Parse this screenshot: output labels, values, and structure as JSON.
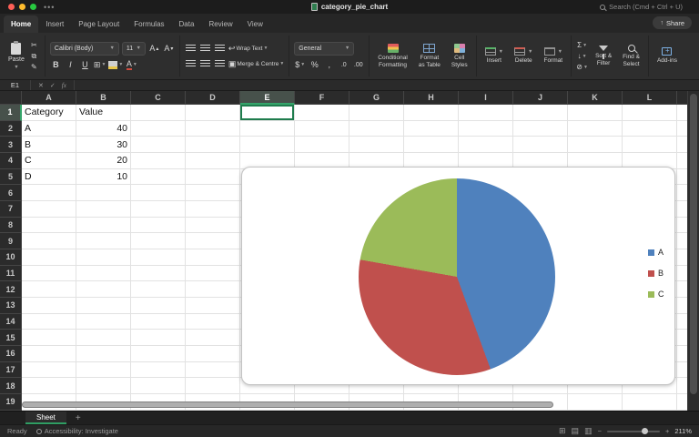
{
  "window": {
    "title": "category_pie_chart",
    "search_label": "Search (Cmd + Ctrl + U)",
    "share_label": "Share"
  },
  "tabs": [
    {
      "label": "Home",
      "active": true
    },
    {
      "label": "Insert",
      "active": false
    },
    {
      "label": "Page Layout",
      "active": false
    },
    {
      "label": "Formulas",
      "active": false
    },
    {
      "label": "Data",
      "active": false
    },
    {
      "label": "Review",
      "active": false
    },
    {
      "label": "View",
      "active": false
    }
  ],
  "ribbon": {
    "paste": "Paste",
    "font_name": "Calibri (Body)",
    "font_size": "11",
    "bold": "B",
    "italic": "I",
    "underline": "U",
    "wrap": "Wrap Text",
    "merge": "Merge & Centre",
    "number_format": "General",
    "cf1": "Conditional",
    "cf2": "Formatting",
    "ft1": "Format",
    "ft2": "as Table",
    "cs1": "Cell",
    "cs2": "Styles",
    "insert": "Insert",
    "delete": "Delete",
    "format": "Format",
    "sf1": "Sort &",
    "sf2": "Filter",
    "fs1": "Find &",
    "fs2": "Select",
    "addins": "Add-ins"
  },
  "formula_bar": {
    "cell_ref": "E1",
    "fx": "fx"
  },
  "grid": {
    "columns": [
      "A",
      "B",
      "C",
      "D",
      "E",
      "F",
      "G",
      "H",
      "I",
      "J",
      "K",
      "L"
    ],
    "row_count": 19,
    "selected_column": "E",
    "selected_row": 1,
    "selected_cell": "E1",
    "cells": [
      {
        "ref": "A1",
        "col": "A",
        "row": 1,
        "text": "Category",
        "align": "left"
      },
      {
        "ref": "B1",
        "col": "B",
        "row": 1,
        "text": "Value",
        "align": "left"
      },
      {
        "ref": "A2",
        "col": "A",
        "row": 2,
        "text": "A",
        "align": "left"
      },
      {
        "ref": "B2",
        "col": "B",
        "row": 2,
        "text": "40",
        "align": "right"
      },
      {
        "ref": "A3",
        "col": "A",
        "row": 3,
        "text": "B",
        "align": "left"
      },
      {
        "ref": "B3",
        "col": "B",
        "row": 3,
        "text": "30",
        "align": "right"
      },
      {
        "ref": "A4",
        "col": "A",
        "row": 4,
        "text": "C",
        "align": "left"
      },
      {
        "ref": "B4",
        "col": "B",
        "row": 4,
        "text": "20",
        "align": "right"
      },
      {
        "ref": "A5",
        "col": "A",
        "row": 5,
        "text": "D",
        "align": "left"
      },
      {
        "ref": "B5",
        "col": "B",
        "row": 5,
        "text": "10",
        "align": "right"
      }
    ]
  },
  "chart_data": {
    "type": "pie",
    "categories": [
      "A",
      "B",
      "C"
    ],
    "values": [
      40,
      30,
      20
    ],
    "colors": [
      "#4F81BD",
      "#C0504D",
      "#9BBB59"
    ],
    "legend_position": "right",
    "title": ""
  },
  "sheet_bar": {
    "tab": "Sheet",
    "add": "+"
  },
  "status_bar": {
    "ready": "Ready",
    "accessibility": "Accessibility: Investigate",
    "zoom": "211%"
  }
}
